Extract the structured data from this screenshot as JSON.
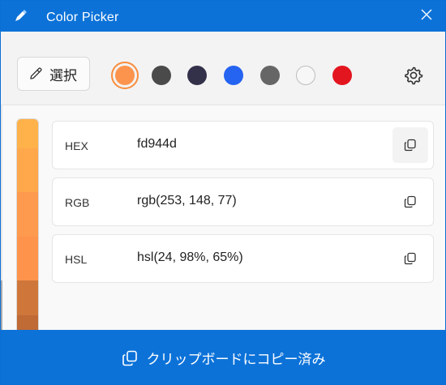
{
  "window": {
    "title": "Color Picker"
  },
  "toolbar": {
    "select_label": "選択",
    "swatches": [
      {
        "color": "#fd944d",
        "selected": true
      },
      {
        "color": "#4a4a4a"
      },
      {
        "color": "#33304a"
      },
      {
        "color": "#2563f1"
      },
      {
        "color": "#666666"
      },
      {
        "color": "#f7f7f7"
      },
      {
        "color": "#e3151f"
      }
    ]
  },
  "formats": [
    {
      "name": "HEX",
      "value": "fd944d"
    },
    {
      "name": "RGB",
      "value": "rgb(253, 148, 77)"
    },
    {
      "name": "HSL",
      "value": "hsl(24, 98%, 65%)"
    }
  ],
  "shades": [
    "#ffb14a",
    "#ffa74b",
    "#fe9a4d",
    "#fe944c",
    "#cf773b",
    "#c06a35"
  ],
  "status": {
    "message": "クリップボードにコピー済み"
  },
  "colors": {
    "accent": "#0c72d8",
    "selected_ring": "#f88d3c"
  }
}
